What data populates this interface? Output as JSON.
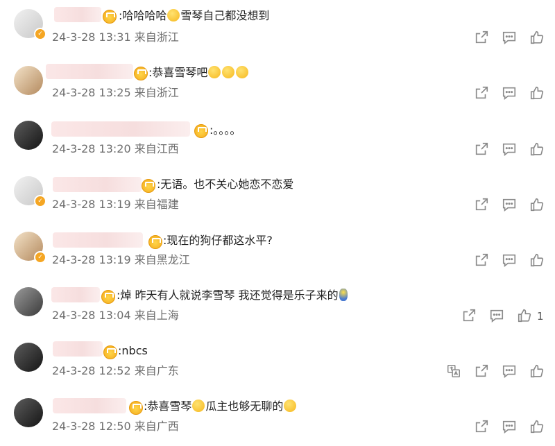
{
  "comments": [
    {
      "text": ":哈哈哈哈",
      "text2": "雪琴自己都没想到",
      "time": "24-3-28 13:31",
      "location": "来自浙江"
    },
    {
      "text": ":恭喜雪琴吧",
      "time": "24-3-28 13:25",
      "location": "来自浙江"
    },
    {
      "text": ":。。。。",
      "time": "24-3-28 13:20",
      "location": "来自江西"
    },
    {
      "text": ":无语。也不关心她恋不恋爱",
      "time": "24-3-28 13:19",
      "location": "来自福建"
    },
    {
      "text": ":现在的狗仔都这水平?",
      "time": "24-3-28 13:19",
      "location": "来自黑龙江"
    },
    {
      "text": ":焯 昨天有人就说李雪琴 我还觉得是乐子来的",
      "time": "24-3-28 13:04",
      "location": "来自上海",
      "like_count": "1"
    },
    {
      "text": ":nbcs",
      "time": "24-3-28 12:52",
      "location": "来自广东"
    },
    {
      "text": ":恭喜雪琴",
      "text2": "瓜主也够无聊的",
      "time": "24-3-28 12:50",
      "location": "来自广西"
    }
  ],
  "icons": {
    "share": "share-icon",
    "comment": "comment-icon",
    "like": "like-icon",
    "translate": "translate-icon",
    "verified": "verified-badge-icon",
    "member": "crown-icon"
  },
  "colors": {
    "text": "#222222",
    "meta": "#6e6e6e",
    "icon": "#8a8a8a",
    "badge": "#f5a623"
  }
}
